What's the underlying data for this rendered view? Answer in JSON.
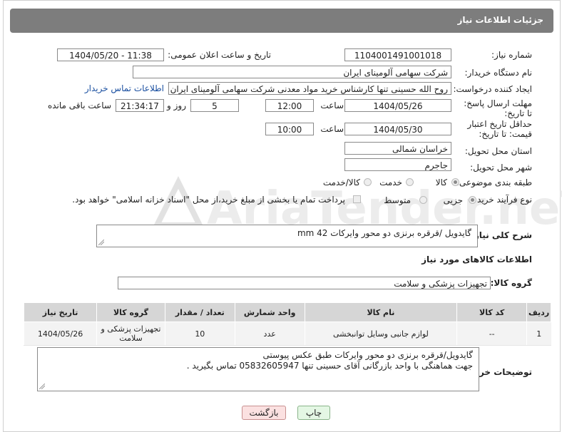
{
  "header": {
    "title": "جزئیات اطلاعات نیاز"
  },
  "fields": {
    "need_number_label": "شماره نیاز:",
    "need_number": "1104001491001018",
    "announce_label": "تاریخ و ساعت اعلان عمومی:",
    "announce_value": "1404/05/20 - 11:38",
    "buyer_org_label": "نام دستگاه خریدار:",
    "buyer_org": "شرکت سهامی آلومینای ایران",
    "requester_label": "ایجاد کننده درخواست:",
    "requester": "روح الله حسینی تنها کارشناس خرید مواد معدنی شرکت سهامی آلومینای ایران",
    "contact_link": "اطلاعات تماس خریدار",
    "deadline_label": "مهلت ارسال پاسخ: تا تاریخ:",
    "deadline_date": "1404/05/26",
    "time_label": "ساعت",
    "deadline_time": "12:00",
    "days_value": "5",
    "days_label": "روز و",
    "remaining_time": "21:34:17",
    "remaining_label": "ساعت باقی مانده",
    "price_validity_label": "حداقل تاریخ اعتبار قیمت: تا تاریخ:",
    "price_validity_date": "1404/05/30",
    "price_validity_time": "10:00",
    "province_label": "استان محل تحویل:",
    "province": "خراسان شمالی",
    "city_label": "شهر محل تحویل:",
    "city": "جاجرم",
    "category_label": "طبقه بندی موضوعی:",
    "category_options": [
      "کالا",
      "خدمت",
      "کالا/خدمت"
    ],
    "process_label": "نوع فرآیند خرید :",
    "process_options": [
      "جزیی",
      "متوسط"
    ],
    "payment_note": "پرداخت تمام یا بخشی از مبلغ خرید،از محل \"اسناد خزانه اسلامی\" خواهد بود.",
    "description_label": "شرح کلی نیاز:",
    "description": "گایدویل /قرقره برنزی دو محور وایرکات 42 mm"
  },
  "goods": {
    "section_title": "اطلاعات کالاهای مورد نیاز",
    "group_label": "گروه کالا:",
    "group_value": "تجهیزات پزشکی و سلامت",
    "columns": [
      "ردیف",
      "کد کالا",
      "نام کالا",
      "واحد شمارش",
      "تعداد / مقدار",
      "گروه کالا",
      "تاریخ نیاز"
    ],
    "rows": [
      {
        "index": "1",
        "code": "--",
        "name": "لوازم جانبی وسایل توانبخشی",
        "unit": "عدد",
        "qty": "10",
        "group": "تجهیزات پزشکی و سلامت",
        "date": "1404/05/26"
      }
    ]
  },
  "buyer_notes": {
    "label": "توضیحات خریدار:",
    "line1": "گایدویل/قرقره برنزی دو محور وایرکات طبق عکس پیوستی",
    "line2": "جهت هماهنگی با واحد بازرگانی آقای حسینی تنها 05832605947 تماس بگیرید ."
  },
  "buttons": {
    "print": "چاپ",
    "back": "بازگشت"
  },
  "watermark": "AriaTender.neT",
  "colors": {
    "titlebar": "#7d7d7d",
    "link": "#1a4fa0",
    "print_bg": "#e4f7e4",
    "back_bg": "#fbe1e1"
  }
}
